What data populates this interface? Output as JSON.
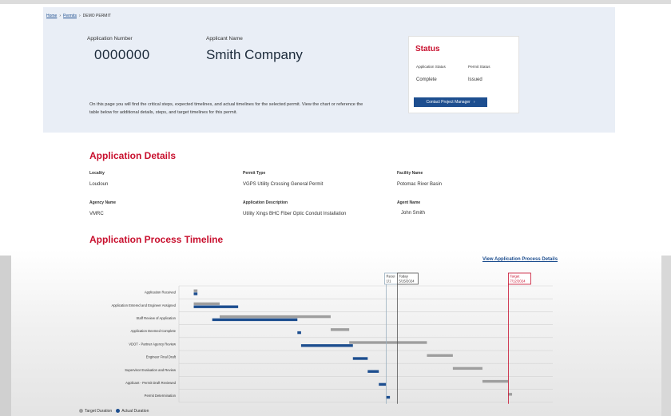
{
  "breadcrumb": {
    "home": "Home",
    "permits": "Permits",
    "current": "DEMO PERMIT"
  },
  "header": {
    "app_number_label": "Application Number",
    "app_number": "0000000",
    "applicant_label": "Applicant Name",
    "applicant": "Smith Company",
    "intro": "On this page you will find the critical steps, expected timelines, and actual timelines for the selected permit. View the chart or reference the table below for additional details, steps, and target timelines for this permit."
  },
  "status": {
    "title": "Status",
    "app_status_label": "Application Status",
    "app_status": "Complete",
    "permit_status_label": "Permit Status",
    "permit_status": "Issued",
    "button_label": "Contact Project Manager",
    "button_icon": "chevron-right-icon"
  },
  "details": {
    "title": "Application Details",
    "locality_label": "Locality",
    "locality": "Loudoun",
    "permit_type_label": "Permit Type",
    "permit_type": "VGPS Utility Crossing General Permit",
    "facility_label": "Facility Name",
    "facility": "Potomac River Basin",
    "agency_label": "Agency Name",
    "agency": "VMRC",
    "description_label": "Application Description",
    "description": "Utility Xings BHC Fiber Optic Conduit Installation",
    "agent_label": "Agent Name",
    "agent": "John Smith"
  },
  "timeline": {
    "title": "Application Process Timeline",
    "details_link": "View Application Process Details",
    "legend_target": "Target Duration",
    "legend_actual": "Actual Duration"
  },
  "chart_data": {
    "type": "bar",
    "categories": [
      "Application Received",
      "Application Entered and Engineer Assigned",
      "Staff Review of Application",
      "Application Deemed Complete",
      "VDOT - Partner Agency Review",
      "Engineer Final Draft",
      "Supervisor Evaluation and Review",
      "Applicant - Permit Draft Reviewed",
      "Permit Determination"
    ],
    "series": [
      {
        "name": "Target Duration",
        "color": "#9e9e9e",
        "ranges": [
          [
            0,
            1
          ],
          [
            0,
            7
          ],
          [
            7,
            37
          ],
          [
            37,
            42
          ],
          [
            42,
            63
          ],
          [
            63,
            70
          ],
          [
            70,
            78
          ],
          [
            78,
            85
          ],
          [
            85,
            86
          ]
        ]
      },
      {
        "name": "Actual Duration",
        "color": "#1d4e8f",
        "ranges": [
          [
            0,
            1
          ],
          [
            0,
            12
          ],
          [
            5,
            28
          ],
          [
            28,
            29
          ],
          [
            29,
            43
          ],
          [
            43,
            47
          ],
          [
            47,
            50
          ],
          [
            50,
            52
          ],
          [
            52,
            53
          ]
        ]
      }
    ],
    "markers": [
      {
        "label": "Recei",
        "sublabel": "1/1",
        "x": 52,
        "color": "#9ab0c0"
      },
      {
        "label": "Today",
        "sublabel": "5/15/2024",
        "x": 55,
        "color": "#555555"
      },
      {
        "label": "Target",
        "sublabel": "7/12/2024",
        "x": 85,
        "color": "#c8102e"
      }
    ],
    "xlim": [
      -4,
      97
    ],
    "grid": true,
    "legend_placement": "bottom-left"
  }
}
